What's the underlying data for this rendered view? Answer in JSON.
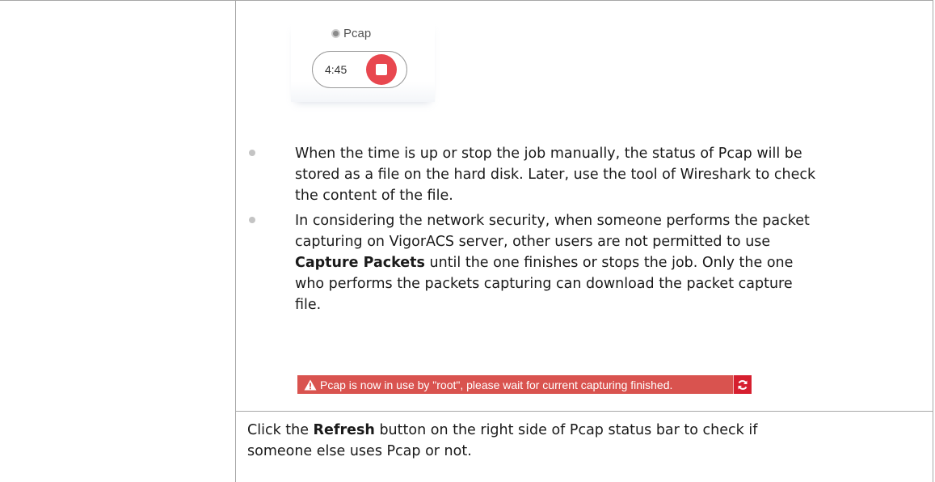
{
  "widget": {
    "title": "Pcap",
    "timer": "4:45"
  },
  "bullets": [
    {
      "text": "When the time is up or stop the job manually, the status of Pcap will be stored as a file on the hard disk. Later, use the tool of Wireshark to check the content of the file."
    },
    {
      "text_before": "In considering the network security, when someone performs the packet capturing on VigorACS server, other users are not permitted to use ",
      "bold": "Capture Packets",
      "text_after": " until the one finishes or stops the job. Only the one who performs the packets capturing can download the packet capture file."
    }
  ],
  "alert": {
    "message": "Pcap is now in use by \"root\", please wait for current capturing finished.",
    "icon": "warning-triangle-icon",
    "button_icon": "refresh-icon",
    "color": "#d9534f"
  },
  "footer": {
    "text_before": "Click the ",
    "bold": "Refresh",
    "text_after": " button on the right side of Pcap status bar to check if someone else uses Pcap or not."
  }
}
